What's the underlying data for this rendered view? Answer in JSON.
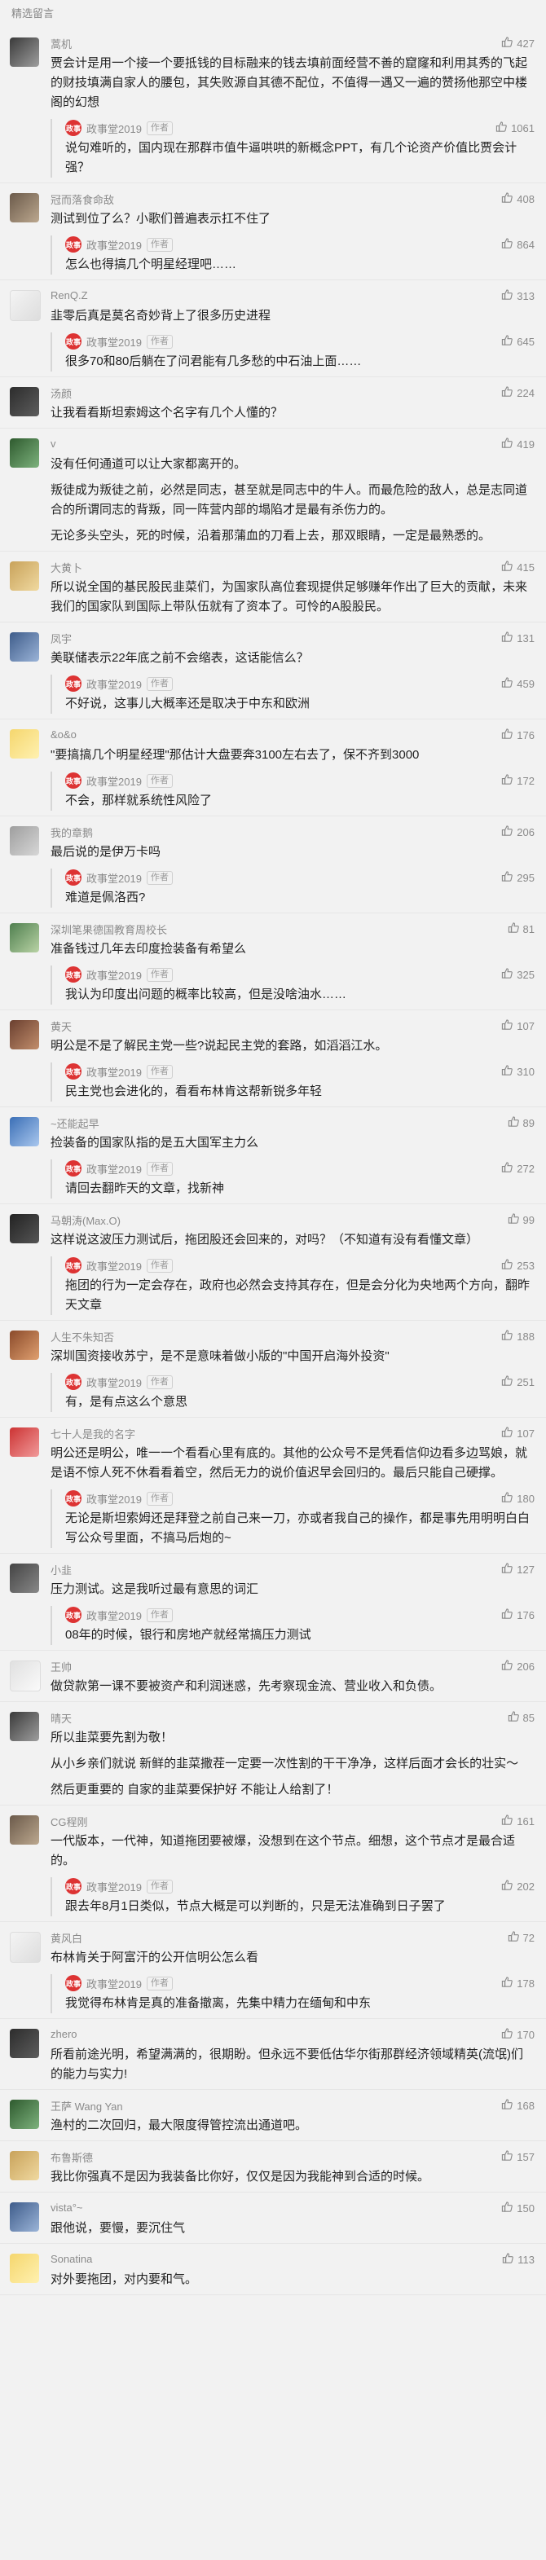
{
  "section_title": "精选留言",
  "author": {
    "name": "政事堂2019",
    "tag": "作者",
    "avatar_text": "政事"
  },
  "comments": [
    {
      "nick": "蒿机",
      "likes": "427",
      "text": [
        "贾会计是用一个接一个要抵钱的目标融来的钱去填前面经营不善的窟窿和利用其秀的飞起的财技填满自家人的腰包，其失败源自其德不配位，不值得一遇又一遍的赞扬他那空中楼阁的幻想"
      ],
      "reply": {
        "likes": "1061",
        "text": [
          "说句难听的，国内现在那群市值牛逼哄哄的新概念PPT，有几个论资产价值比贾会计强？"
        ]
      }
    },
    {
      "nick": "冠而落食命敌",
      "likes": "408",
      "text": [
        "测试到位了么？小歌们普遍表示扛不住了"
      ],
      "reply": {
        "likes": "864",
        "text": [
          "怎么也得搞几个明星经理吧……"
        ]
      }
    },
    {
      "nick": "RenQ.Z",
      "likes": "313",
      "text": [
        "韭零后真是莫名奇妙背上了很多历史进程"
      ],
      "reply": {
        "likes": "645",
        "text": [
          "很多70和80后躺在了问君能有几多愁的中石油上面……"
        ]
      }
    },
    {
      "nick": "汤颜",
      "likes": "224",
      "text": [
        "让我看看斯坦索姆这个名字有几个人懂的？"
      ],
      "reply": null
    },
    {
      "nick": "v",
      "likes": "419",
      "text": [
        "没有任何通道可以让大家都离开的。",
        "叛徒成为叛徒之前，必然是同志，甚至就是同志中的牛人。而最危险的敌人，总是志同道合的所谓同志的背叛，同一阵营内部的塌陷才是最有杀伤力的。",
        "无论多头空头，死的时候，沿着那蒲血的刀看上去，那双眼睛，一定是最熟悉的。"
      ],
      "reply": null
    },
    {
      "nick": "大黄卜",
      "likes": "415",
      "text": [
        "所以说全国的基民股民韭菜们，为国家队高位套现提供足够赚年作出了巨大的贡献，未来我们的国家队到国际上带队伍就有了资本了。可怜的A股股民。"
      ],
      "reply": null
    },
    {
      "nick": "凤宇",
      "likes": "131",
      "text": [
        "美联储表示22年底之前不会缩表，这话能信么？"
      ],
      "reply": {
        "likes": "459",
        "text": [
          "不好说，这事儿大概率还是取决于中东和欧洲"
        ]
      }
    },
    {
      "nick": "&o&o",
      "likes": "176",
      "text": [
        "\"要搞搞几个明星经理\"那估计大盘要奔3100左右去了，保不齐到3000"
      ],
      "reply": {
        "likes": "172",
        "text": [
          "不会，那样就系统性风险了"
        ]
      }
    },
    {
      "nick": "我的章鹅",
      "likes": "206",
      "text": [
        "最后说的是伊万卡吗"
      ],
      "reply": {
        "likes": "295",
        "text": [
          "难道是佩洛西?"
        ]
      }
    },
    {
      "nick": "深圳笔果德国教育周校长",
      "likes": "81",
      "text": [
        "准备钱过几年去印度捡装备有希望么"
      ],
      "reply": {
        "likes": "325",
        "text": [
          "我认为印度出问题的概率比较高，但是没啥油水……"
        ]
      }
    },
    {
      "nick": "黄天",
      "likes": "107",
      "text": [
        "明公是不是了解民主党一些?说起民主党的套路，如滔滔江水。"
      ],
      "reply": {
        "likes": "310",
        "text": [
          "民主党也会进化的，看看布林肯这帮新锐多年轻"
        ]
      }
    },
    {
      "nick": "~还能起早",
      "likes": "89",
      "text": [
        "捡装备的国家队指的是五大国军主力么"
      ],
      "reply": {
        "likes": "272",
        "text": [
          "请回去翻昨天的文章，找新神"
        ]
      }
    },
    {
      "nick": "马朝涛(Max.O)",
      "likes": "99",
      "text": [
        "这样说这波压力测试后，拖团股还会回来的，对吗？（不知道有没有看懂文章）"
      ],
      "reply": {
        "likes": "253",
        "text": [
          "拖团的行为一定会存在，政府也必然会支持其存在，但是会分化为央地两个方向，翻昨天文章"
        ]
      }
    },
    {
      "nick": "人生不朱知否",
      "likes": "188",
      "text": [
        "深圳国资接收苏宁，是不是意味着做小版的\"中国开启海外投资\""
      ],
      "reply": {
        "likes": "251",
        "text": [
          "有，是有点这么个意思"
        ]
      }
    },
    {
      "nick": "七十人是我的名字",
      "likes": "107",
      "text": [
        "明公还是明公，唯一一个看看心里有底的。其他的公众号不是凭看信仰边看多边骂娘，就是语不惊人死不休看看着空，然后无力的说价值迟早会回归的。最后只能自己硬撑。"
      ],
      "reply": {
        "likes": "180",
        "text": [
          "无论是斯坦索姆还是拜登之前自己来一刀，亦或者我自己的操作，都是事先用明明白白写公众号里面，不搞马后炮的~"
        ]
      }
    },
    {
      "nick": "小韭",
      "likes": "127",
      "text": [
        "压力测试。这是我听过最有意思的词汇"
      ],
      "reply": {
        "likes": "176",
        "text": [
          "08年的时候，银行和房地产就经常搞压力测试"
        ]
      }
    },
    {
      "nick": "王帅",
      "likes": "206",
      "text": [
        "做贷款第一课不要被资产和利润迷惑，先考察现金流、营业收入和负债。"
      ],
      "reply": null
    },
    {
      "nick": "晴天",
      "likes": "85",
      "text": [
        "所以韭菜要先割为敬！",
        "从小乡亲们就说 新鲜的韭菜撒茬一定要一次性割的干干净净，这样后面才会长的壮实～",
        "然后更重要的 自家的韭菜要保护好 不能让人给割了！"
      ],
      "reply": null
    },
    {
      "nick": "CG程刚",
      "likes": "161",
      "text": [
        "一代版本，一代神，知道拖团要被爆，没想到在这个节点。细想，这个节点才是最合适的。"
      ],
      "reply": {
        "likes": "202",
        "text": [
          "跟去年8月1日类似，节点大概是可以判断的，只是无法准确到日子罢了"
        ]
      }
    },
    {
      "nick": "黄风白",
      "likes": "72",
      "text": [
        "布林肯关于阿富汗的公开信明公怎么看"
      ],
      "reply": {
        "likes": "178",
        "text": [
          "我觉得布林肯是真的准备撤离，先集中精力在缅甸和中东"
        ]
      }
    },
    {
      "nick": "zhero",
      "likes": "170",
      "text": [
        "所看前途光明，希望满满的，很期盼。但永远不要低估华尔街那群经济领域精英(流氓)们的能力与实力!"
      ],
      "reply": null
    },
    {
      "nick": "王萨 Wang Yan",
      "likes": "168",
      "text": [
        "渔村的二次回归，最大限度得管控流出通道吧。"
      ],
      "reply": null
    },
    {
      "nick": "布鲁斯德",
      "likes": "157",
      "text": [
        "我比你强真不是因为我装备比你好，仅仅是因为我能神到合适的时候。"
      ],
      "reply": null
    },
    {
      "nick": "vista°~",
      "likes": "150",
      "text": [
        "跟他说，要慢，要沉住气"
      ],
      "reply": null
    },
    {
      "nick": "Sonatina",
      "likes": "113",
      "text": [
        "对外要拖团，对内要和气。"
      ],
      "reply": null
    }
  ]
}
